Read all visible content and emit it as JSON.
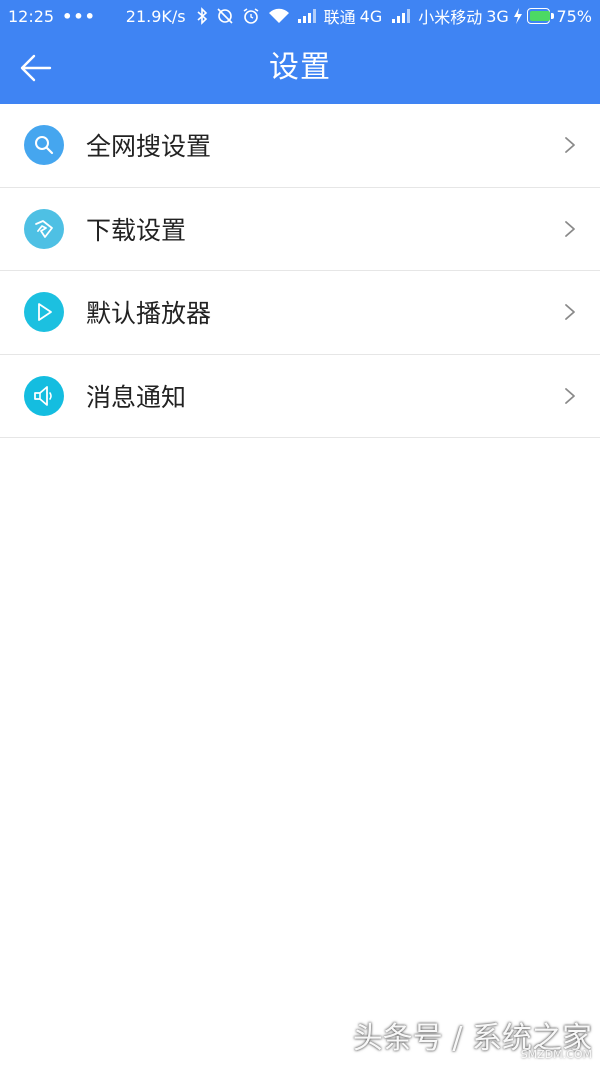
{
  "status_bar": {
    "time": "12:25",
    "dots": "•••",
    "net_speed": "21.9K/s",
    "carrier1": "联通",
    "net1": "4G",
    "carrier2": "小米移动",
    "net2": "3G",
    "battery_level": 0.75,
    "battery_text": "75%",
    "icons": [
      "bluetooth-icon",
      "sync-off-icon",
      "alarm-icon",
      "wifi-icon",
      "signal-icon",
      "signal-icon",
      "charging-icon",
      "battery-icon"
    ]
  },
  "header": {
    "title": "设置",
    "back_icon": "arrow-left-icon",
    "background_color": "#3f84f3"
  },
  "settings": {
    "items": [
      {
        "label": "全网搜设置",
        "icon": "search-icon",
        "icon_color": "#45a6ef"
      },
      {
        "label": "下载设置",
        "icon": "download-icon",
        "icon_color": "#4ec0e4"
      },
      {
        "label": "默认播放器",
        "icon": "play-icon",
        "icon_color": "#1cc0e0"
      },
      {
        "label": "消息通知",
        "icon": "speaker-icon",
        "icon_color": "#14bde0"
      }
    ],
    "chevron_icon": "chevron-right-icon"
  },
  "watermark": {
    "text": "头条号 / 系统之家",
    "sub": "SMZDM.COM"
  }
}
